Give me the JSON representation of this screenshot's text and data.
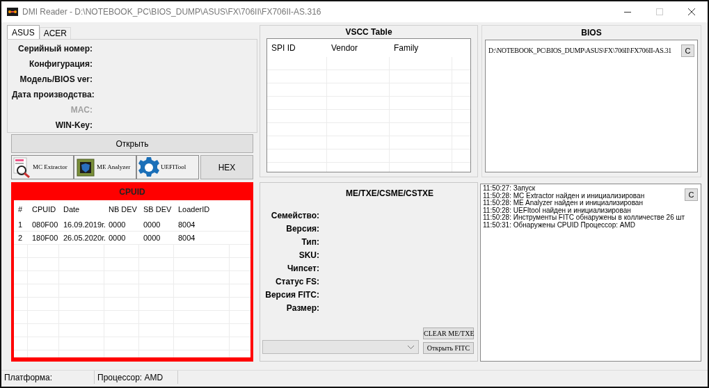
{
  "window": {
    "title": "DMI Reader - D:\\NOTEBOOK_PC\\BIOS_DUMP\\ASUS\\FX\\706II\\FX706II-AS.316"
  },
  "tabs": [
    {
      "label": "ASUS",
      "selected": true
    },
    {
      "label": "ACER",
      "selected": false
    }
  ],
  "dmi_fields": [
    {
      "label": "Серийный номер:",
      "disabled": false
    },
    {
      "label": "Конфигурация:",
      "disabled": false
    },
    {
      "label": "Модель/BIOS ver:",
      "disabled": false
    },
    {
      "label": "Дата производства:",
      "disabled": false
    },
    {
      "label": "MAC:",
      "disabled": true
    },
    {
      "label": "WIN-Key:",
      "disabled": false
    }
  ],
  "open_button": "Открыть",
  "tools": [
    {
      "kind": "mc",
      "label": "MC Extractor"
    },
    {
      "kind": "me",
      "label": "ME Analyzer"
    },
    {
      "kind": "uefi",
      "label": "UEFITool"
    }
  ],
  "hex_button": "HEX",
  "cpuid": {
    "title": "CPUID",
    "columns": [
      "#",
      "CPUID",
      "Date",
      "NB DEV",
      "SB DEV",
      "LoaderID"
    ],
    "rows": [
      [
        "1",
        "080F00",
        "16.09.2019г.",
        "0000",
        "0000",
        "8004"
      ],
      [
        "2",
        "180F00",
        "26.05.2020г.",
        "0000",
        "0000",
        "8004"
      ]
    ]
  },
  "vscc": {
    "title": "VSCC Table",
    "columns": [
      "SPI ID",
      "Vendor",
      "Family"
    ]
  },
  "me": {
    "title": "ME/TXE/CSME/CSTXE",
    "fields": [
      "Семейство:",
      "Версия:",
      "Тип:",
      "SKU:",
      "Чипсет:",
      "Статус FS:",
      "Версия FITC:",
      "Размер:"
    ],
    "clear_button": "CLEAR ME/TXE",
    "fitc_button": "Открыть FITC"
  },
  "bios": {
    "title": "BIOS",
    "path": "D:\\NOTEBOOK_PC\\BIOS_DUMP\\ASUS\\FX\\706II\\FX706II-AS.31",
    "clear_button": "C"
  },
  "log": {
    "clear_button": "C",
    "lines": [
      "11:50:27: Запуск",
      "11:50:28: MC Extractor найден и инициализирован",
      "11:50:28: ME Analyzer найден и инициализирован",
      "11:50:28: UEFItool найден и инициализирован",
      "11:50:28: Инструменты FITC обнаружены в колличестве 26 шт",
      "11:50:31: Обнаружены CPUID Процессор: AMD"
    ]
  },
  "status_bar": [
    "Платформа:",
    "Процессор: AMD"
  ]
}
